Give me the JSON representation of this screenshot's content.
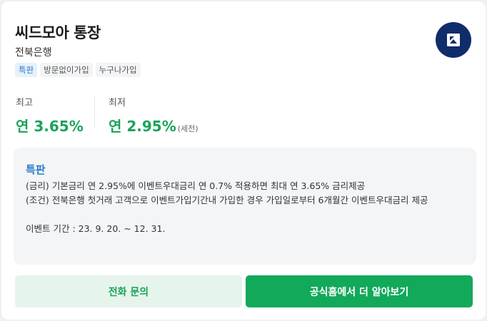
{
  "product": {
    "title": "씨드모아 통장",
    "bank": "전북은행",
    "tags": [
      {
        "label": "특판",
        "kind": "special"
      },
      {
        "label": "방문없이가입",
        "kind": "normal"
      },
      {
        "label": "누구나가입",
        "kind": "normal"
      }
    ],
    "logo_icon": "bank-logo-icon",
    "logo_color": "#0f2d6b"
  },
  "rates": {
    "max_label": "최고",
    "max_value": "연 3.65%",
    "min_label": "최저",
    "min_value": "연 2.95%",
    "min_note": "(세전)"
  },
  "promo": {
    "title": "특판",
    "line1": "(금리) 기본금리 연 2.95%에 이벤트우대금리 연 0.7% 적용하면 최대 연 3.65% 금리제공",
    "line2": "(조건) 전북은행 첫거래 고객으로 이벤트가입기간내 가입한 경우 가입일로부터 6개월간 이벤트우대금리 제공",
    "line3": "이벤트 기간 : 23. 9. 20. ~ 12. 31."
  },
  "actions": {
    "call_label": "전화 문의",
    "site_label": "공식홈에서 더 알아보기"
  },
  "colors": {
    "accent_green": "#1aa35a",
    "accent_blue": "#2a7bc8"
  }
}
